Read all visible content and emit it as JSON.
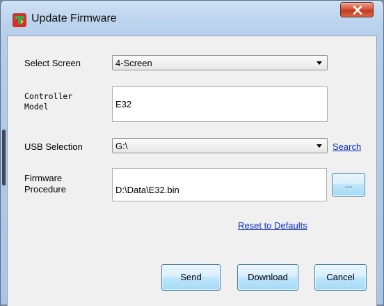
{
  "window": {
    "title": "Update Firmware",
    "icons": {
      "app": "firmware-app-icon",
      "close": "close-icon"
    }
  },
  "form": {
    "select_screen": {
      "label": "Select Screen",
      "value": "4-Screen"
    },
    "controller_model": {
      "label_line1": "Controller",
      "label_line2": "Model",
      "value": "E32"
    },
    "usb_selection": {
      "label": "USB Selection",
      "value": "G:\\",
      "search_link": "Search"
    },
    "firmware_procedure": {
      "label_line1": "Firmware",
      "label_line2": "Procedure",
      "value": "D:\\Data\\E32.bin",
      "browse_label": "..."
    },
    "reset_link": "Reset to Defaults"
  },
  "buttons": {
    "send": "Send",
    "download": "Download",
    "cancel": "Cancel"
  },
  "colors": {
    "link": "#0c2ed6",
    "close_button": "#c2391f",
    "button_border": "#3c7fb1"
  }
}
